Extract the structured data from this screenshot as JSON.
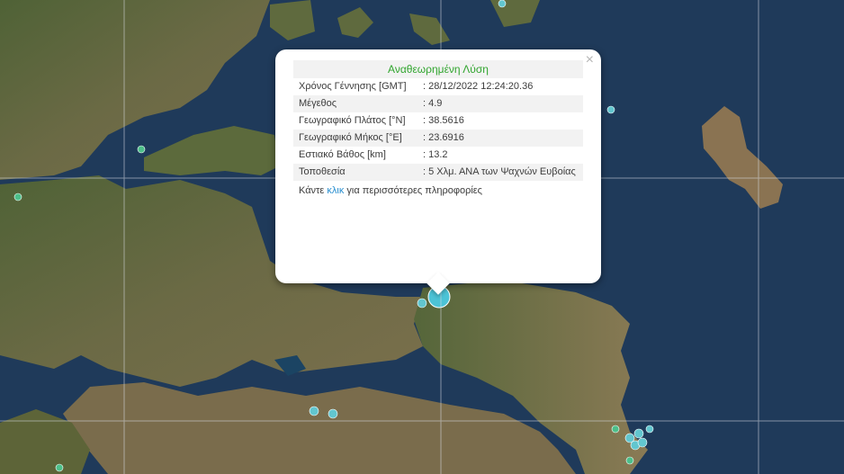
{
  "popup": {
    "title": "Αναθεωρημένη Λύση",
    "close_glyph": "×",
    "rows": [
      {
        "label": "Χρόνος Γέννησης [GMT]",
        "value": ": 28/12/2022 12:24:20.36"
      },
      {
        "label": "Μέγεθος",
        "value": ": 4.9"
      },
      {
        "label": "Γεωγραφικό Πλάτος [°N]",
        "value": ": 38.5616"
      },
      {
        "label": "Γεωγραφικό Μήκος [°E]",
        "value": ": 23.6916"
      },
      {
        "label": "Εστιακό Βάθος [km]",
        "value": ": 13.2"
      },
      {
        "label": "Τοποθεσία",
        "value": ": 5 Χλμ. ΑΝΑ των Ψαχνών Ευβοίας"
      }
    ],
    "more_prefix": "Κάντε ",
    "more_link": "κλικ",
    "more_suffix": " για περισσότερες πληροφορίες"
  },
  "colors": {
    "sea": "#1f3a5a",
    "land": "#5b6a3a",
    "marker_main": "#4cc3d6",
    "marker_recent": "#62c6cf",
    "marker_old": "#4dbf8a",
    "accent_green": "#31a52f",
    "link_blue": "#2a8fd0"
  }
}
